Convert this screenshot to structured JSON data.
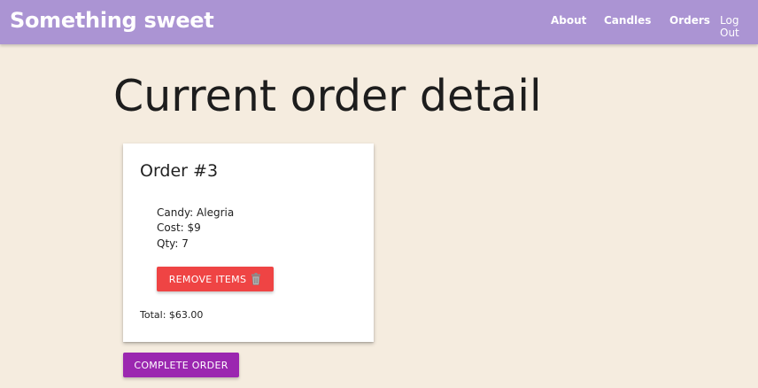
{
  "navbar": {
    "brand": "Something sweet",
    "links": {
      "about": "About",
      "candles": "Candles",
      "orders": "Orders",
      "logout": "Log Out"
    },
    "background_color": "#ab94d3"
  },
  "page": {
    "title": "Current order detail"
  },
  "order": {
    "title": "Order #3",
    "item": {
      "candy": "Candy: Alegria",
      "cost": "Cost: $9",
      "qty": "Qty: 7"
    },
    "remove_label": "REMOVE ITEMS",
    "remove_icon": "trash-icon",
    "total": "Total: $63.00"
  },
  "actions": {
    "complete_label": "COMPLETE ORDER"
  },
  "colors": {
    "background": "#f5ecdf",
    "remove_button": "#ef4444",
    "complete_button": "#9b27b0"
  }
}
